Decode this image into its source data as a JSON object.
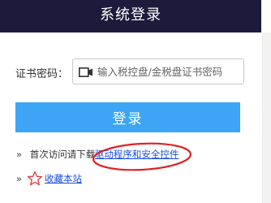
{
  "header": {
    "title": "系统登录"
  },
  "form": {
    "cert_label": "证书密码：",
    "cert_placeholder": "输入税控盘/金税盘证书密码",
    "login_label": "登录"
  },
  "links": {
    "download_prefix": "首次访问请下载",
    "download_link": "驱动程序和安全控件",
    "favorite_link": "收藏本站"
  },
  "colors": {
    "header_bg": "#1d1a3b",
    "button_bg": "#3da5f4",
    "link": "#1a4ee0",
    "annotation": "#e02020"
  },
  "icons": {
    "field_icon": "key-card-icon",
    "favorite_icon": "star-icon"
  }
}
